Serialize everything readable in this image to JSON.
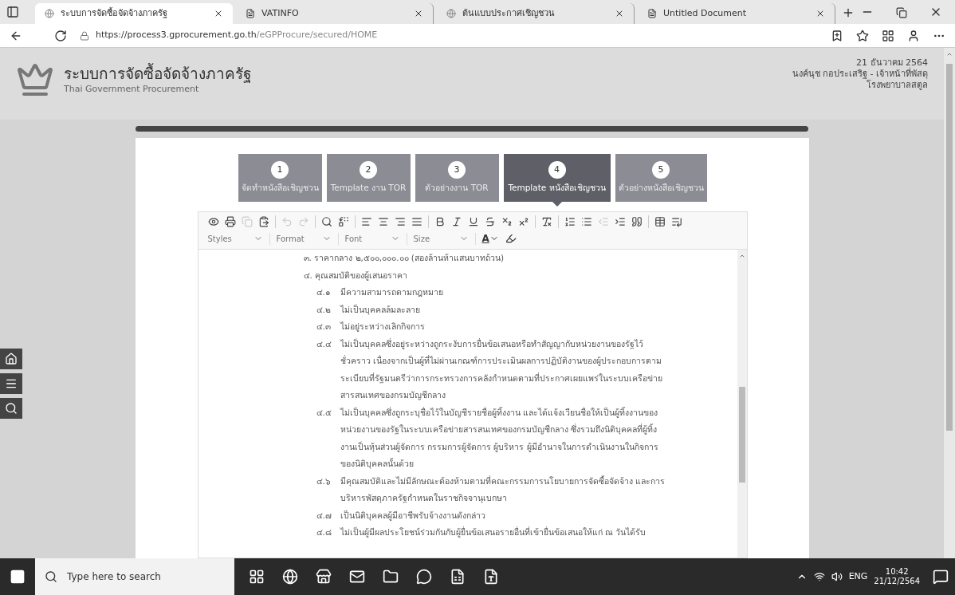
{
  "browser": {
    "tabs": [
      {
        "label": "ระบบการจัดซื้อจัดจ้างภาครัฐ",
        "selected": true,
        "kind": "site"
      },
      {
        "label": "VATINFO",
        "selected": false,
        "kind": "page"
      },
      {
        "label": "ต้นแบบประกาศเชิญชวน",
        "selected": false,
        "kind": "site"
      },
      {
        "label": "Untitled Document",
        "selected": false,
        "kind": "page"
      }
    ],
    "url_host": "https://process3.gprocurement.go.th",
    "url_path": "/eGPProcure/secured/HOME"
  },
  "header": {
    "title": "ระบบการจัดซื้อจัดจ้างภาครัฐ",
    "subtitle": "Thai Government Procurement",
    "date": "21 ธันวาคม 2564",
    "user": "นงค์นุช กอประเสริฐ - เจ้าหน้าที่พัสดุ",
    "organization": "โรงพยาบาลสตูล"
  },
  "steps": [
    {
      "number": "1",
      "label": "จัดทำหนังสือเชิญชวน",
      "selected": false
    },
    {
      "number": "2",
      "label": "Template งาน TOR",
      "selected": false
    },
    {
      "number": "3",
      "label": "ตัวอย่างงาน TOR",
      "selected": false
    },
    {
      "number": "4",
      "label": "Template หนังสือเชิญชวน",
      "selected": true
    },
    {
      "number": "5",
      "label": "ตัวอย่างหนังสือเชิญชวน",
      "selected": false
    }
  ],
  "editor": {
    "toolbar": [
      {
        "disabled": false
      },
      {
        "disabled": false
      },
      {
        "disabled": true
      },
      {
        "disabled": false
      },
      {
        "disabled": true
      },
      {
        "disabled": true
      },
      {
        "disabled": false
      },
      {
        "disabled": false
      },
      {
        "disabled": false
      },
      {
        "disabled": false
      },
      {
        "disabled": false
      },
      {
        "disabled": false
      },
      {
        "disabled": false
      },
      {
        "disabled": false
      },
      {
        "disabled": false
      },
      {
        "disabled": false
      },
      {
        "disabled": false
      },
      {
        "disabled": false
      },
      {
        "disabled": false
      },
      {
        "disabled": false
      },
      {
        "disabled": false
      },
      {
        "disabled": true
      },
      {
        "disabled": false
      },
      {
        "disabled": false
      },
      {
        "disabled": false
      },
      {
        "disabled": false
      }
    ],
    "dropdowns": [
      "Styles",
      "Format",
      "Font",
      "Size"
    ],
    "text_color": "A",
    "document": {
      "cut_line": "๓. ราคากลาง ๒,๕๐๐,๐๐๐.๐๐ (สองล้านห้าแสนบาทถ้วน)",
      "heading": "๔. คุณสมบัติของผู้เสนอราคา",
      "items": [
        {
          "number": "๔.๑",
          "text": "มีความสามารถตามกฎหมาย"
        },
        {
          "number": "๔.๒",
          "text": "ไม่เป็นบุคคลล้มละลาย"
        },
        {
          "number": "๔.๓",
          "text": "ไม่อยู่ระหว่างเลิกกิจการ"
        },
        {
          "number": "๔.๔",
          "text": "ไม่เป็นบุคคลซึ่งอยู่ระหว่างถูกระงับการยื่นข้อเสนอหรือทำสัญญากับหน่วยงานของรัฐไว้ชั่วคราว เนื่องจากเป็นผู้ที่ไม่ผ่านเกณฑ์การประเมินผลการปฏิบัติงานของผู้ประกอบการตามระเบียบที่รัฐมนตรีว่าการกระทรวงการคลังกำหนดตามที่ประกาศเผยแพร่ในระบบเครือข่ายสารสนเทศของกรมบัญชีกลาง"
        },
        {
          "number": "๔.๕",
          "text": "ไม่เป็นบุคคลซึ่งถูกระบุชื่อไว้ในบัญชีรายชื่อผู้ทิ้งงาน และได้แจ้งเวียนชื่อให้เป็นผู้ทิ้งงานของหน่วยงานของรัฐในระบบเครือข่ายสารสนเทศของกรมบัญชีกลาง ซึ่งรวมถึงนิติบุคคลที่ผู้ทิ้งงานเป็นหุ้นส่วนผู้จัดการ กรรมการผู้จัดการ ผู้บริหาร ผู้มีอำนาจในการดำเนินงานในกิจการของนิติบุคคลนั้นด้วย"
        },
        {
          "number": "๔.๖",
          "text": "มีคุณสมบัติและไม่มีลักษณะต้องห้ามตามที่คณะกรรมการนโยบายการจัดซื้อจัดจ้าง และการบริหารพัสดุภาครัฐกำหนดในราชกิจจานุเบกษา"
        },
        {
          "number": "๔.๗",
          "text": "เป็นนิติบุคคลผู้มีอาชีพรับจ้างงานดังกล่าว"
        },
        {
          "number": "๔.๘",
          "text": "ไม่เป็นผู้มีผลประโยชน์ร่วมกันกับผู้ยื่นข้อเสนอรายอื่นที่เข้ายื่นข้อเสนอให้แก่ ณ วันได้รับ"
        }
      ]
    }
  },
  "taskbar": {
    "search_placeholder": "Type here to search",
    "language": "ENG",
    "time": "10:42",
    "date": "21/12/2564"
  }
}
